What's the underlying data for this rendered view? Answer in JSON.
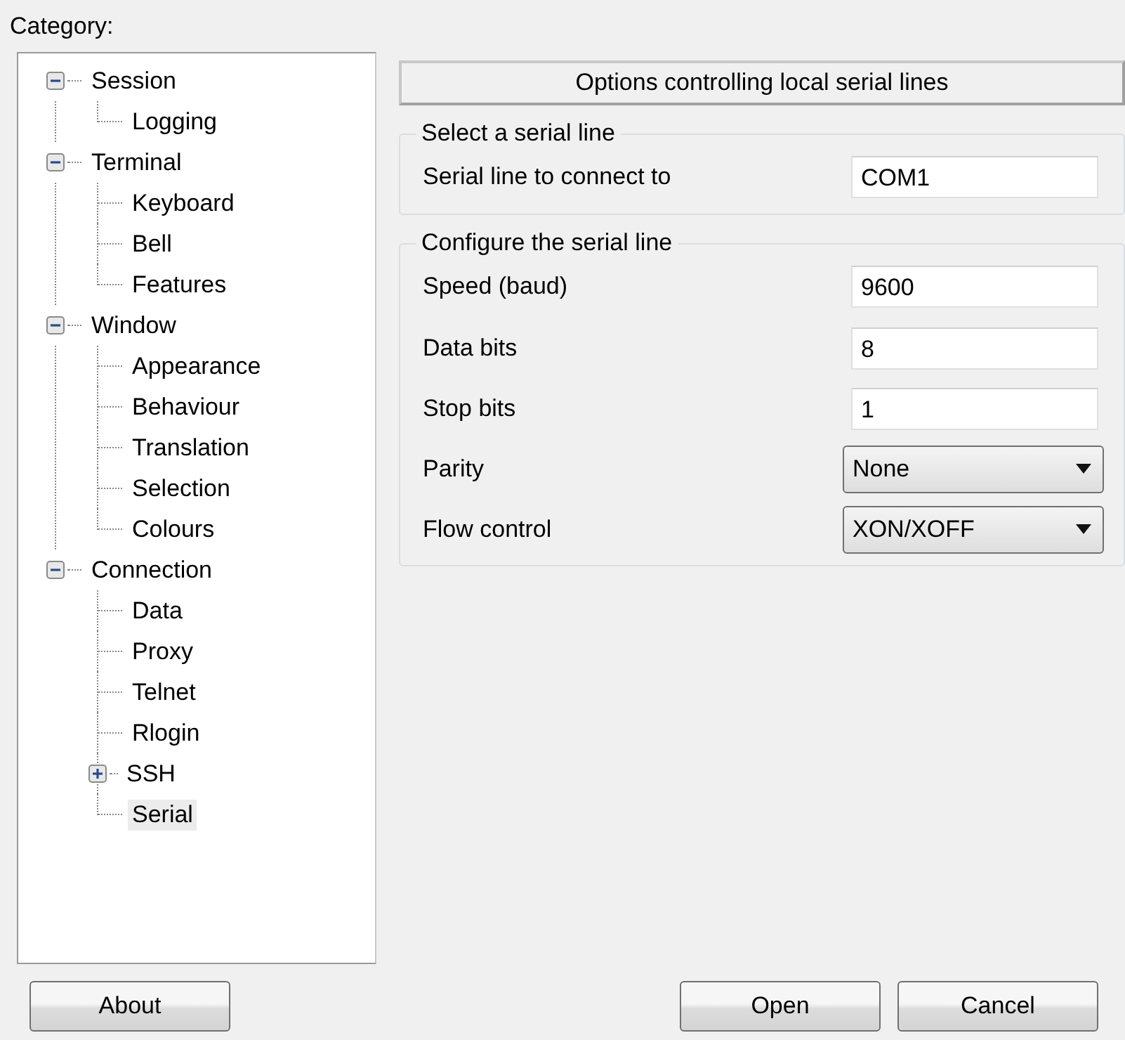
{
  "category_label": "Category:",
  "tree": [
    {
      "label": "Session",
      "expanded": true,
      "selected": false,
      "children": [
        {
          "label": "Logging",
          "selected": false
        }
      ]
    },
    {
      "label": "Terminal",
      "expanded": true,
      "selected": false,
      "children": [
        {
          "label": "Keyboard",
          "selected": false
        },
        {
          "label": "Bell",
          "selected": false
        },
        {
          "label": "Features",
          "selected": false
        }
      ]
    },
    {
      "label": "Window",
      "expanded": true,
      "selected": false,
      "children": [
        {
          "label": "Appearance",
          "selected": false
        },
        {
          "label": "Behaviour",
          "selected": false
        },
        {
          "label": "Translation",
          "selected": false
        },
        {
          "label": "Selection",
          "selected": false
        },
        {
          "label": "Colours",
          "selected": false
        }
      ]
    },
    {
      "label": "Connection",
      "expanded": true,
      "selected": false,
      "children": [
        {
          "label": "Data",
          "selected": false
        },
        {
          "label": "Proxy",
          "selected": false
        },
        {
          "label": "Telnet",
          "selected": false
        },
        {
          "label": "Rlogin",
          "selected": false
        },
        {
          "label": "SSH",
          "selected": false,
          "expanded": false
        },
        {
          "label": "Serial",
          "selected": true
        }
      ]
    }
  ],
  "panel_title": "Options controlling local serial lines",
  "groups": [
    {
      "title": "Select a serial line",
      "fields": [
        {
          "kind": "text",
          "label": "Serial line to connect to",
          "value": "COM1"
        }
      ]
    },
    {
      "title": "Configure the serial line",
      "fields": [
        {
          "kind": "text",
          "label": "Speed (baud)",
          "value": "9600"
        },
        {
          "kind": "text",
          "label": "Data bits",
          "value": "8"
        },
        {
          "kind": "text",
          "label": "Stop bits",
          "value": "1"
        },
        {
          "kind": "dropdown",
          "label": "Parity",
          "value": "None"
        },
        {
          "kind": "dropdown",
          "label": "Flow control",
          "value": "XON/XOFF"
        }
      ]
    }
  ],
  "buttons": {
    "left": [
      "About"
    ],
    "right": [
      "Open",
      "Cancel"
    ]
  }
}
